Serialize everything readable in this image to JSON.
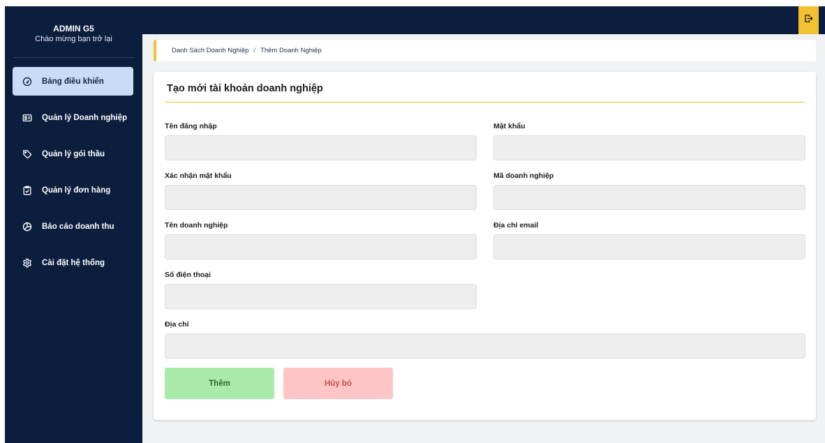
{
  "brand": {
    "title": "ADMIN G5",
    "subtitle": "Chào mừng bạn trở lại"
  },
  "sidebar": {
    "items": [
      {
        "label": "Bảng điều khiển",
        "icon": "gauge-icon",
        "active": true
      },
      {
        "label": "Quản lý Doanh nghiệp",
        "icon": "id-card-icon",
        "active": false
      },
      {
        "label": "Quản lý gói thầu",
        "icon": "tag-icon",
        "active": false
      },
      {
        "label": "Quản lý đơn hàng",
        "icon": "clipboard-check-icon",
        "active": false
      },
      {
        "label": "Báo cáo doanh thu",
        "icon": "pie-chart-icon",
        "active": false
      },
      {
        "label": "Cài đặt hệ thống",
        "icon": "gear-icon",
        "active": false
      }
    ]
  },
  "topbar": {
    "logout_icon": "logout-icon"
  },
  "breadcrumb": {
    "parent": "Danh Sách Doanh Nghiệp",
    "separator": "/",
    "current": "Thêm Doanh Nghiệp"
  },
  "form": {
    "title": "Tạo mới tài khoản doanh nghiệp",
    "fields": {
      "username": {
        "label": "Tên đăng nhập",
        "value": "",
        "placeholder": ""
      },
      "password": {
        "label": "Mật khẩu",
        "value": "",
        "placeholder": ""
      },
      "confirm_password": {
        "label": "Xác nhận mật khẩu",
        "value": "",
        "placeholder": ""
      },
      "company_code": {
        "label": "Mã doanh nghiệp",
        "value": "",
        "placeholder": ""
      },
      "company_name": {
        "label": "Tên doanh nghiệp",
        "value": "",
        "placeholder": ""
      },
      "email": {
        "label": "Địa chỉ email",
        "value": "",
        "placeholder": ""
      },
      "phone": {
        "label": "Số điện thoại",
        "value": "",
        "placeholder": ""
      },
      "address": {
        "label": "Địa chỉ",
        "value": "",
        "placeholder": ""
      }
    },
    "add_label": "Thêm",
    "cancel_label": "Hủy bỏ"
  },
  "colors": {
    "sidebar_bg": "#0c1e3e",
    "active_nav_bg": "#c9dcf7",
    "accent": "#f2c230",
    "input_bg": "#eeeeee",
    "add_btn_bg": "#a8eaa9",
    "cancel_btn_bg": "#ffc5c5"
  }
}
